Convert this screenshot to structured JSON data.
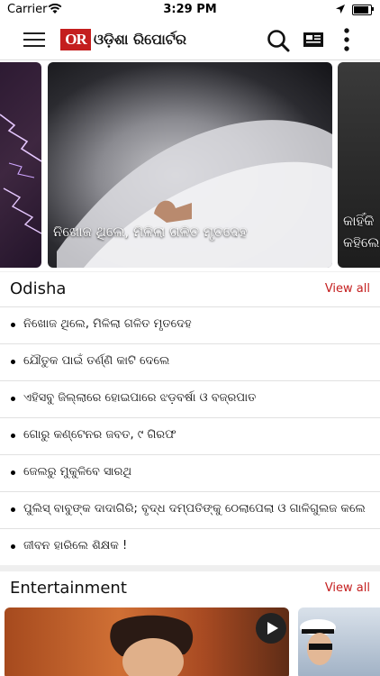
{
  "status_bar": {
    "carrier": "Carrier",
    "time": "3:29 PM",
    "battery_level": 0.9
  },
  "app_bar": {
    "logo_mark": "OR",
    "logo_text": "ଓଡ଼ିଶା ରିପୋର୍ଟର",
    "icons": [
      "menu-icon",
      "search-icon",
      "newspaper-icon",
      "more-vert-icon"
    ]
  },
  "carousel": {
    "slides": [
      {
        "caption": ""
      },
      {
        "caption": "ନିଖୋଜ ଥିଲେ, ମିଳିଲା ଗଳିତ ମୃତଦେହ"
      },
      {
        "caption_line1": "କାହିଁକି",
        "caption_line2": "କହିଲେ"
      }
    ]
  },
  "odisha": {
    "title": "Odisha",
    "view_all": "View all",
    "items": [
      "ନିଖୋଜ ଥିଲେ, ମିଳିଲା ଗଳିତ ମୃତଦେହ",
      "ଯୌତୁକ ପାଇଁ ତର୍ଣ୍ଣି କାଟି ଦେଲେ",
      "ଏହିସବୁ ଜିଲ୍ଲାରେ ହୋଇପାରେ ଝଡ଼ବର୍ଷା ଓ ବଜ୍ରପାତ",
      "ଗୋରୁ କଣ୍ଟେନର ଜବତ, ୯ ଗିରଫ",
      "ଜେଲରୁ ମୁକୁଳିବେ ସାରଥି",
      "ପୁଲିସ୍ ବାବୁଙ୍କ ଦାଦାଗିରି; ବୃଦ୍ଧ ଦମ୍ପତିଙ୍କୁ ଠେଲାପେଲା ଓ ଗାଳିଗୁଲଜ କଲେ",
      "ଜୀବନ ହାରିଲେ ଶିକ୍ଷକ !"
    ]
  },
  "entertainment": {
    "title": "Entertainment",
    "view_all": "View all"
  },
  "colors": {
    "accent": "#c41e1e",
    "text": "#111111",
    "divider": "#e1e1e1",
    "background": "#efefef"
  }
}
